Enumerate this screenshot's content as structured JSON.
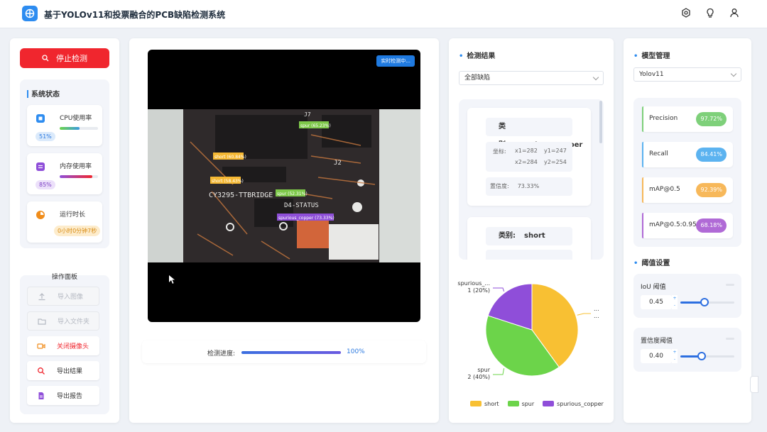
{
  "app": {
    "title": "基于YOLOv11和投票融合的PCB缺陷检测系统"
  },
  "colors": {
    "primary": "#2d8cf0",
    "danger": "#f0262e"
  },
  "left": {
    "stop_button": "停止检测",
    "status_title": "系统状态",
    "stats": [
      {
        "label": "CPU使用率",
        "value": "51%",
        "level": 0.51,
        "icon": "cpu-icon"
      },
      {
        "label": "内存使用率",
        "value": "85%",
        "level": 0.85,
        "icon": "memory-icon"
      },
      {
        "label": "运行时长",
        "value": "0小时0分钟7秒",
        "icon": "clock-icon"
      }
    ],
    "ops_title": "操作面板",
    "ops": [
      {
        "label": "导入图像",
        "icon": "upload-icon",
        "disabled": true
      },
      {
        "label": "导入文件夹",
        "icon": "folder-icon",
        "disabled": true
      },
      {
        "label": "关闭摄像头",
        "icon": "camera-icon",
        "disabled": false
      },
      {
        "label": "导出结果",
        "icon": "search-icon",
        "disabled": false
      },
      {
        "label": "导出报告",
        "icon": "report-icon",
        "disabled": false
      }
    ]
  },
  "video": {
    "live_badge": "实时检测中...",
    "detections": [
      {
        "label": "spur (65.23%)",
        "color": "#7ec84a"
      },
      {
        "label": "short (60.84%)",
        "color": "#f5b833"
      },
      {
        "label": "short (58.43%)",
        "color": "#f5b833"
      },
      {
        "label": "spur (52.31%)",
        "color": "#7ec84a"
      },
      {
        "label": "spurious_copper (73.33%)",
        "color": "#8e4fd8"
      }
    ],
    "pcb_text": {
      "ref": "CY3295-TTBRIDGE",
      "status": "D4-STATUS",
      "j7": "J7",
      "j2": "J2"
    }
  },
  "progress": {
    "label": "检测进度:",
    "value": "100%",
    "fraction": 1.0
  },
  "results": {
    "title": "检测结果",
    "filter": "全部缺陷",
    "items": [
      {
        "class_label": "类别:",
        "class": "spurious_copper",
        "coord_label": "坐标:",
        "x1": "x1=282",
        "y1": "y1=247",
        "x2": "x2=284",
        "y2": "y2=254",
        "conf_label": "置信度:",
        "conf": "73.33%"
      },
      {
        "class_label": "类别:",
        "class": "short"
      }
    ]
  },
  "chart_data": {
    "type": "pie",
    "categories": [
      "short",
      "spur",
      "spurious_copper"
    ],
    "values": [
      2,
      2,
      1
    ],
    "colors": [
      "#f8c033",
      "#6cd44a",
      "#8f4ed9"
    ],
    "labels": [
      {
        "name": "spurious_...",
        "value": "1 (20%)"
      },
      {
        "name": "spur",
        "value": "2 (40%)"
      },
      {
        "name": "...",
        "value": "..."
      }
    ],
    "legend": "bottom"
  },
  "model": {
    "title": "模型管理",
    "selected": "Yolov11",
    "metrics": [
      {
        "label": "Precision",
        "value": "97.72%",
        "color": "#7ed07a"
      },
      {
        "label": "Recall",
        "value": "84.41%",
        "color": "#5cb3f0"
      },
      {
        "label": "mAP@0.5",
        "value": "92.39%",
        "color": "#f7b85a"
      },
      {
        "label": "mAP@0.5:0.95",
        "value": "68.18%",
        "color": "#b06ad6"
      }
    ]
  },
  "thresholds": {
    "title": "阈值设置",
    "iou": {
      "label": "IoU 阈值",
      "value": "0.45",
      "level": 0.45
    },
    "conf": {
      "label": "置信度阈值",
      "value": "0.40",
      "level": 0.4
    }
  }
}
